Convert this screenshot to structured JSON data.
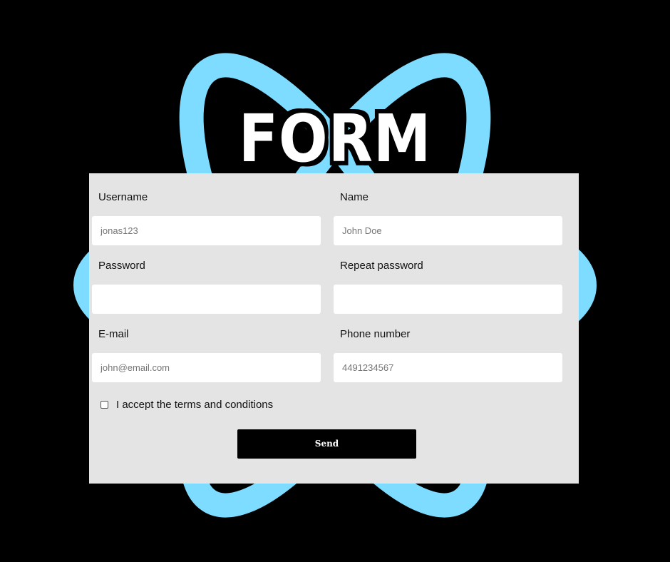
{
  "title": "FORM",
  "colors": {
    "background": "#000000",
    "logo_accent": "#7ddcff",
    "panel": "#e4e4e4",
    "button": "#000000"
  },
  "logo_icon": "react-atom-logo",
  "form": {
    "username": {
      "label": "Username",
      "placeholder": "jonas123"
    },
    "name": {
      "label": "Name",
      "placeholder": "John Doe"
    },
    "password": {
      "label": "Password",
      "placeholder": ""
    },
    "repeat_password": {
      "label": "Repeat password",
      "placeholder": ""
    },
    "email": {
      "label": "E-mail",
      "placeholder": "john@email.com"
    },
    "phone": {
      "label": "Phone number",
      "placeholder": "4491234567"
    },
    "terms_label": "I accept the terms and conditions",
    "terms_checked": false,
    "submit_label": "Send"
  }
}
